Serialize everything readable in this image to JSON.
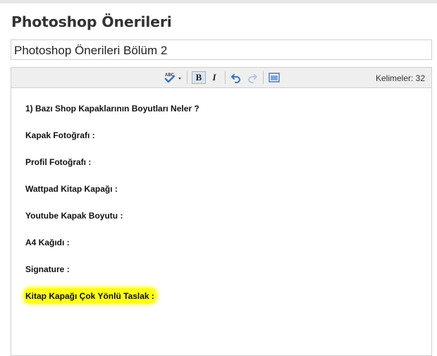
{
  "page": {
    "title": "Photoshop Önerileri",
    "post_title_value": "Photoshop Önerileri Bölüm 2"
  },
  "toolbar": {
    "buttons": [
      {
        "name": "spellcheck",
        "icon": "spellcheck-icon",
        "label": "ABC"
      },
      {
        "name": "bold",
        "icon": "bold-icon",
        "label": "B",
        "active": true
      },
      {
        "name": "italic",
        "icon": "italic-icon",
        "label": "I"
      },
      {
        "name": "undo",
        "icon": "undo-icon"
      },
      {
        "name": "redo",
        "icon": "redo-icon",
        "disabled": true
      },
      {
        "name": "fullscreen",
        "icon": "fullscreen-icon"
      }
    ],
    "word_count_label": "Kelimeler: 32"
  },
  "editor": {
    "paragraphs": [
      "1) Bazı Shop Kapaklarının Boyutları Neler ?",
      "Kapak Fotoğrafı :",
      "Profil Fotoğrafı :",
      "Wattpad Kitap Kapağı :",
      "Youtube Kapak Boyutu :",
      "A4 Kağıdı :",
      "Signature :",
      "Kitap Kapağı Çok Yönlü Taslak :"
    ],
    "highlight_color": "#ffff1a"
  },
  "colors": {
    "title": "#333333",
    "border": "#cfcfcf",
    "toolbar_bg": "#efefef",
    "accent_blue": "#3b73b9"
  }
}
